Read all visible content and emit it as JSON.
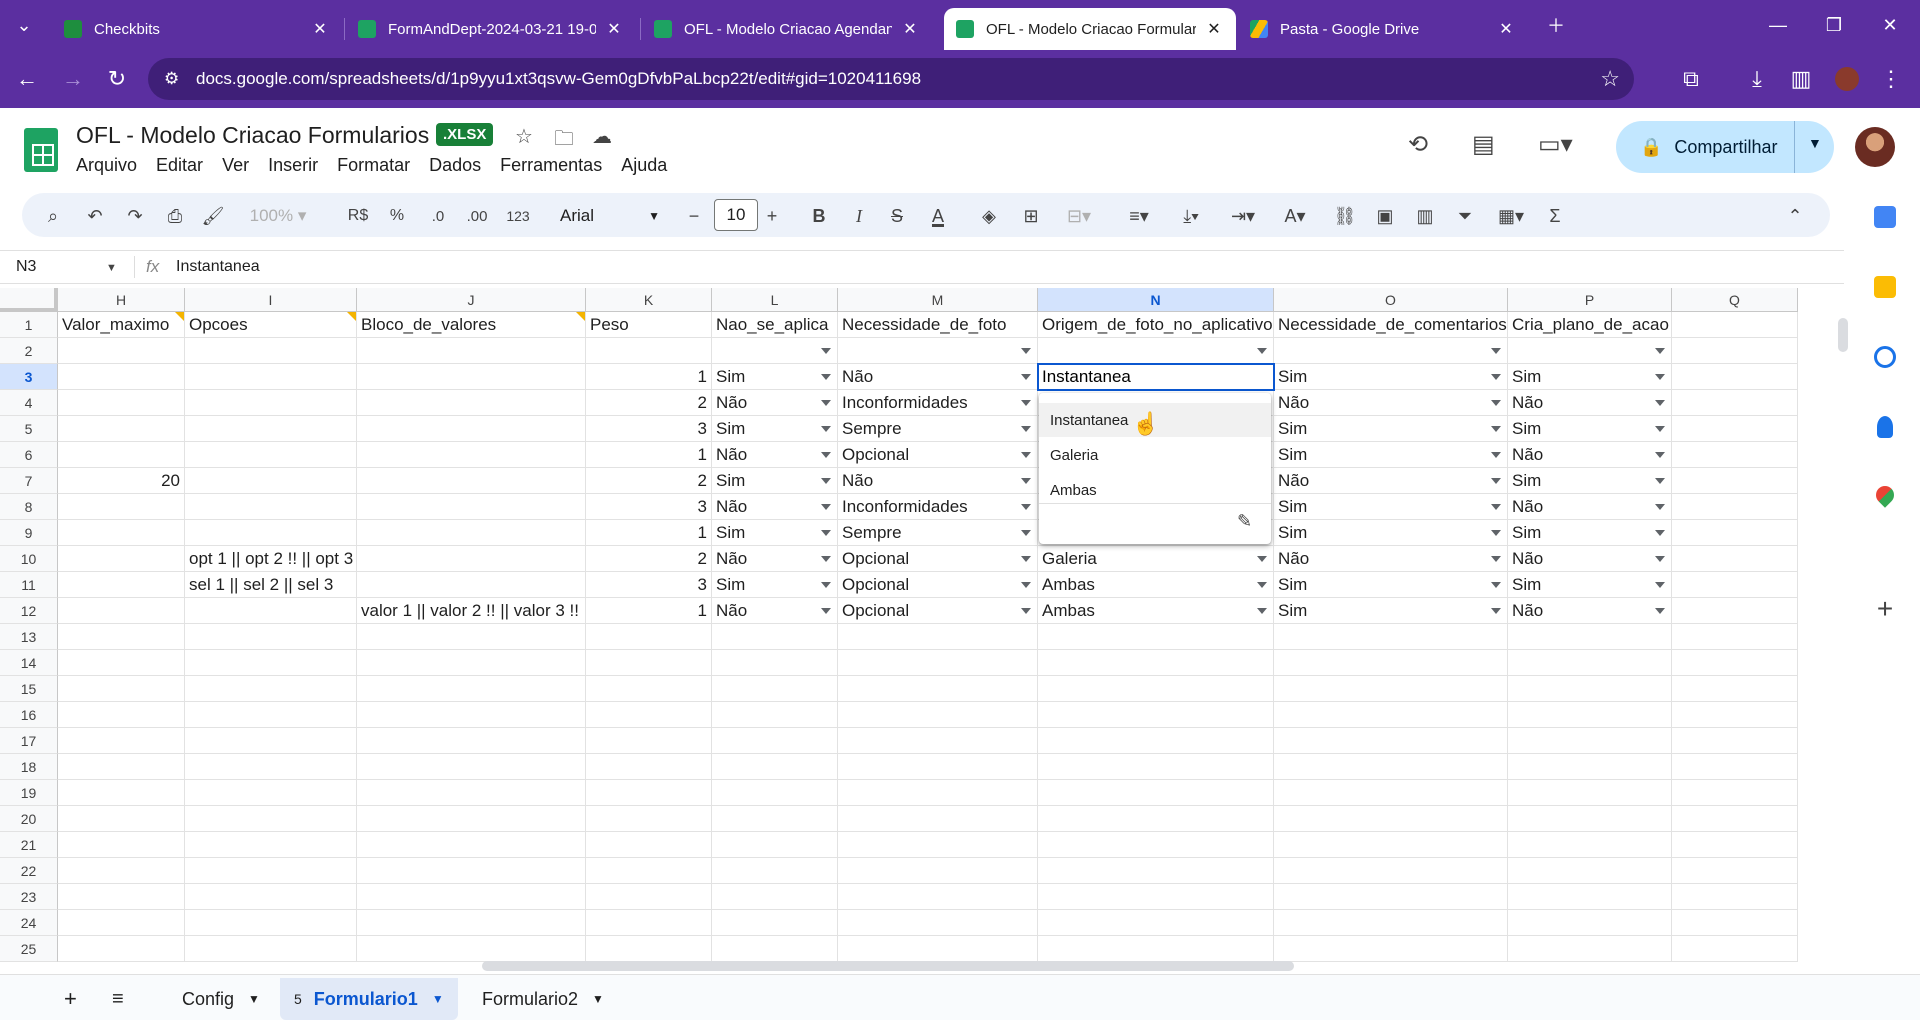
{
  "browser": {
    "tabs": [
      {
        "title": "Checkbits",
        "color": "#1e8e3e"
      },
      {
        "title": "FormAndDept-2024-03-21 19-0",
        "color": "#1ea362"
      },
      {
        "title": "OFL - Modelo Criacao Agendan",
        "color": "#1ea362"
      },
      {
        "title": "OFL - Modelo Criacao Formular",
        "color": "#1ea362"
      },
      {
        "title": "Pasta - Google Drive",
        "color": "#fbbc04"
      }
    ],
    "url": "docs.google.com/spreadsheets/d/1p9yyu1xt3qsvw-Gem0gDfvbPaLbcp22t/edit#gid=1020411698"
  },
  "doc": {
    "title": "OFL - Modelo Criacao Formularios",
    "badge": ".XLSX",
    "menu": [
      "Arquivo",
      "Editar",
      "Ver",
      "Inserir",
      "Formatar",
      "Dados",
      "Ferramentas",
      "Ajuda"
    ],
    "share_label": "Compartilhar"
  },
  "toolbar": {
    "zoom": "100%",
    "currency": "R$",
    "percent": "%",
    "dec_minus": ".0",
    "dec_plus": ".00",
    "number_format": "123",
    "font": "Arial",
    "font_size": "10"
  },
  "formula_bar": {
    "cell_ref": "N3",
    "fx": "fx",
    "value": "Instantanea"
  },
  "grid": {
    "columns": [
      "H",
      "I",
      "J",
      "K",
      "L",
      "M",
      "N",
      "O",
      "P",
      "Q"
    ],
    "selected_column": "N",
    "rows": [
      "1",
      "2",
      "3",
      "4",
      "5",
      "6",
      "7",
      "8",
      "9",
      "10",
      "11",
      "12",
      "13",
      "14",
      "15",
      "16",
      "17",
      "18",
      "19",
      "20",
      "21",
      "22",
      "23",
      "24",
      "25"
    ],
    "selected_row": "3",
    "header_row": [
      "Valor_maximo",
      "Opcoes",
      "Bloco_de_valores",
      "Peso",
      "Nao_se_aplica",
      "Necessidade_de_foto",
      "Origem_de_foto_no_aplicativo",
      "Necessidade_de_comentarios",
      "Cria_plano_de_acao",
      ""
    ],
    "data_rows": [
      {
        "row": "3",
        "H": "",
        "I": "",
        "J": "",
        "K": "1",
        "L": "Sim",
        "M": "Não",
        "N": "Instantanea",
        "O": "Sim",
        "P": "Sim"
      },
      {
        "row": "4",
        "H": "",
        "I": "",
        "J": "",
        "K": "2",
        "L": "Não",
        "M": "Inconformidades",
        "N": "",
        "O": "Não",
        "P": "Não"
      },
      {
        "row": "5",
        "H": "",
        "I": "",
        "J": "",
        "K": "3",
        "L": "Sim",
        "M": "Sempre",
        "N": "",
        "O": "Sim",
        "P": "Sim"
      },
      {
        "row": "6",
        "H": "",
        "I": "",
        "J": "",
        "K": "1",
        "L": "Não",
        "M": "Opcional",
        "N": "",
        "O": "Sim",
        "P": "Não"
      },
      {
        "row": "7",
        "H": "20",
        "I": "",
        "J": "",
        "K": "2",
        "L": "Sim",
        "M": "Não",
        "N": "",
        "O": "Não",
        "P": "Sim"
      },
      {
        "row": "8",
        "H": "",
        "I": "",
        "J": "",
        "K": "3",
        "L": "Não",
        "M": "Inconformidades",
        "N": "",
        "O": "Sim",
        "P": "Não"
      },
      {
        "row": "9",
        "H": "",
        "I": "",
        "J": "",
        "K": "1",
        "L": "Sim",
        "M": "Sempre",
        "N": "",
        "O": "Sim",
        "P": "Sim"
      },
      {
        "row": "10",
        "H": "",
        "I": "opt 1 || opt 2 !! || opt 3",
        "J": "",
        "K": "2",
        "L": "Não",
        "M": "Opcional",
        "N": "Galeria",
        "O": "Não",
        "P": "Não"
      },
      {
        "row": "11",
        "H": "",
        "I": "sel 1 || sel 2 || sel 3",
        "J": "",
        "K": "3",
        "L": "Sim",
        "M": "Opcional",
        "N": "Ambas",
        "O": "Sim",
        "P": "Sim"
      },
      {
        "row": "12",
        "H": "",
        "I": "",
        "J": "valor 1 || valor 2 !! || valor 3 !!",
        "K": "1",
        "L": "Não",
        "M": "Opcional",
        "N": "Ambas",
        "O": "Sim",
        "P": "Não"
      }
    ]
  },
  "dropdown_popup": {
    "options": [
      "Instantanea",
      "Galeria",
      "Ambas"
    ],
    "hovered": "Instantanea"
  },
  "sheets": {
    "tabs": [
      "Config",
      "Formulario1",
      "Formulario2"
    ],
    "active": "Formulario1",
    "active_badge": "5"
  }
}
